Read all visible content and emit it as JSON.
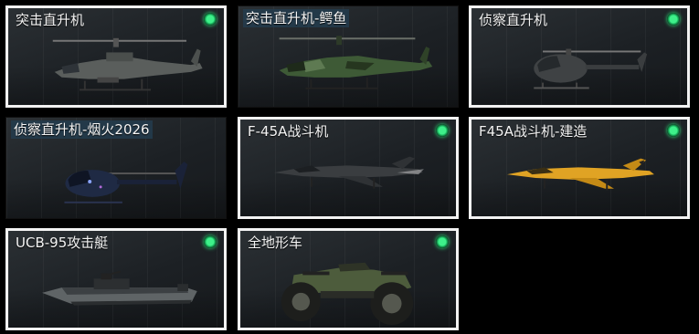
{
  "vehicles": [
    {
      "name": "突击直升机",
      "equipped": true
    },
    {
      "name": "突击直升机-鳄鱼",
      "equipped": false
    },
    {
      "name": "侦察直升机",
      "equipped": true
    },
    {
      "name": "侦察直升机-烟火2026",
      "equipped": false
    },
    {
      "name": "F-45A战斗机",
      "equipped": true
    },
    {
      "name": "F45A战斗机-建造",
      "equipped": true
    },
    {
      "name": "UCB-95攻击艇",
      "equipped": true
    },
    {
      "name": "全地形车",
      "equipped": true
    }
  ],
  "colors": {
    "equipped_indicator": "#2ee07a",
    "selected_border": "#f2f2f2",
    "skin_yellow": "#e0a324",
    "skin_camo": "#3e5a36",
    "skin_night": "#1f2a44"
  },
  "icons": [
    "apache-helicopter-icon",
    "apache-croc-helicopter-icon",
    "scout-helicopter-icon",
    "scout-fireworks-helicopter-icon",
    "f45a-jet-icon",
    "f45a-yellow-jet-icon",
    "attack-boat-icon",
    "atv-icon",
    "equipped-dot-icon"
  ]
}
